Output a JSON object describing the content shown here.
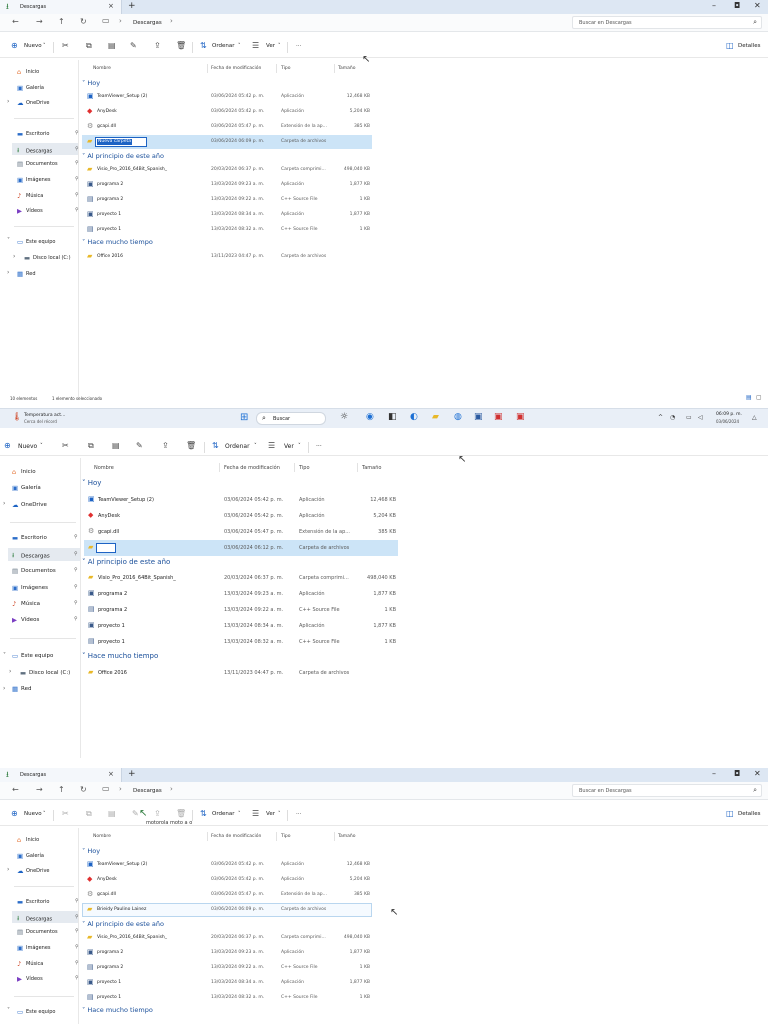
{
  "titlebar": {
    "tab_label": "Descargas",
    "close_glyph": "×",
    "add_glyph": "+",
    "min_glyph": "–",
    "max_glyph": "◘",
    "exit_glyph": "✕"
  },
  "address": {
    "folder": "Descargas",
    "search_placeholder": "Buscar en Descargas"
  },
  "commands": {
    "new": "Nuevo",
    "sort": "Ordenar",
    "view": "Ver",
    "more": "···",
    "details": "Detalles"
  },
  "sidebar": {
    "home": "Inicio",
    "gallery": "Galería",
    "onedrive": "OneDrive",
    "desktop": "Escritorio",
    "downloads": "Descargas",
    "documents": "Documentos",
    "pictures": "Imágenes",
    "music": "Música",
    "videos": "Vídeos",
    "this_pc": "Este equipo",
    "local_disk": "Disco local (C:)",
    "network": "Red"
  },
  "columns": {
    "name": "Nombre",
    "modified": "Fecha de modificación",
    "type": "Tipo",
    "size": "Tamaño"
  },
  "groups": {
    "today": "Hoy",
    "early_year": "Al principio de este año",
    "long_ago": "Hace mucho tiempo"
  },
  "files": {
    "teamviewer": {
      "name": "TeamViewer_Setup (2)",
      "date": "03/06/2024 05:42 p. m.",
      "type": "Aplicación",
      "size": "12,468 KB"
    },
    "anydesk": {
      "name": "AnyDesk",
      "date": "03/06/2024 05:42 p. m.",
      "type": "Aplicación",
      "size": "5,204 KB"
    },
    "gcapi": {
      "name": "gcapi.dll",
      "date": "03/06/2024 05:47 p. m.",
      "type": "Extensión de la ap...",
      "size": "385 KB"
    },
    "newfolder_p1": {
      "name": "Nueva carpeta",
      "date": "03/06/2024 06:09 p. m.",
      "type": "Carpeta de archivos",
      "size": ""
    },
    "newfolder_p2": {
      "date": "03/06/2024 06:12 p. m.",
      "type": "Carpeta de archivos"
    },
    "newfolder_p3": {
      "name": "Brieidy Paulino Lainez",
      "date": "03/06/2024 06:09 p. m.",
      "type": "Carpeta de archivos"
    },
    "visio": {
      "name": "Visio_Pro_2016_64Bit_Spanish_",
      "date": "20/03/2024 06:37 p. m.",
      "type": "Carpeta comprimi...",
      "size": "498,040 KB"
    },
    "prog2_exe": {
      "name": "programa 2",
      "date": "13/03/2024 09:23 a. m.",
      "type": "Aplicación",
      "size": "1,877 KB"
    },
    "prog2_cpp": {
      "name": "programa 2",
      "date": "13/03/2024 09:22 a. m.",
      "type": "C++ Source File",
      "size": "1 KB"
    },
    "proy1_exe": {
      "name": "proyecto 1",
      "date": "13/03/2024 08:34 a. m.",
      "type": "Aplicación",
      "size": "1,877 KB"
    },
    "proy1_cpp": {
      "name": "proyecto 1",
      "date": "13/03/2024 08:32 a. m.",
      "type": "C++ Source File",
      "size": "1 KB"
    },
    "office": {
      "name": "Office 2016",
      "date": "13/11/2023 04:47 p. m.",
      "type": "Carpeta de archivos",
      "size": ""
    }
  },
  "status": {
    "count": "10 elementos",
    "selected": "1 elemento seleccionado"
  },
  "taskbar": {
    "weather_title": "Temperatura act...",
    "weather_sub": "Cerca del récord",
    "search": "Buscar",
    "time": "06:09 p. m.",
    "date": "03/06/2024"
  },
  "tooltip_text": "motorola moto a o",
  "colors": {
    "selection": "#cce4f7",
    "accent": "#1d63c4",
    "group_header": "#1a4f9a"
  }
}
